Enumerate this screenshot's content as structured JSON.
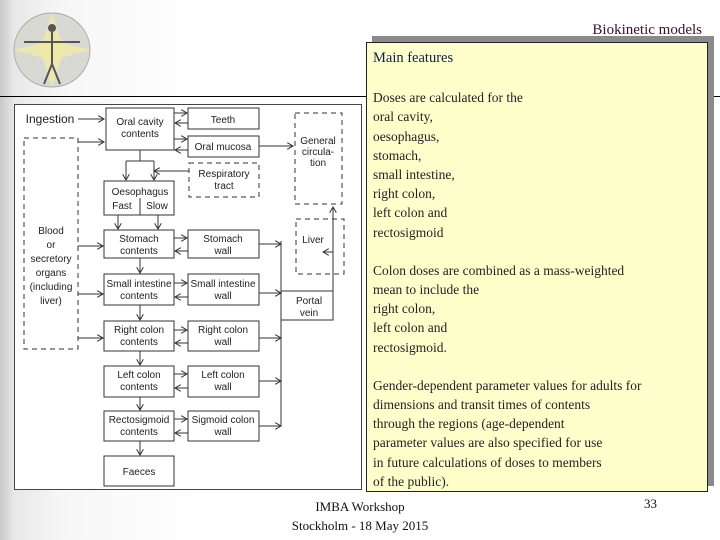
{
  "header": {
    "title": "Biokinetic models",
    "logo": "vitruvian-man-logo"
  },
  "diagram": {
    "ingestion": "Ingestion",
    "oral_cavity": [
      "Oral cavity",
      "contents"
    ],
    "teeth": "Teeth",
    "oral_mucosa": "Oral mucosa",
    "general_circulation": [
      "General",
      "circula-",
      "tion"
    ],
    "respiratory": [
      "Respiratory",
      "tract"
    ],
    "oesophagus": {
      "label": "Oesophagus",
      "fast": "Fast",
      "slow": "Slow"
    },
    "blood": [
      "Blood",
      "or",
      "secretory",
      "organs",
      "(including",
      "liver)"
    ],
    "stomach_contents": [
      "Stomach",
      "contents"
    ],
    "stomach_wall": [
      "Stomach",
      "wall"
    ],
    "liver": "Liver",
    "si_contents": [
      "Small intestine",
      "contents"
    ],
    "si_wall": [
      "Small intestine",
      "wall"
    ],
    "portal_vein": [
      "Portal",
      "vein"
    ],
    "rc_contents": [
      "Right colon",
      "contents"
    ],
    "rc_wall": [
      "Right colon",
      "wall"
    ],
    "lc_contents": [
      "Left colon",
      "contents"
    ],
    "lc_wall": [
      "Left colon",
      "wall"
    ],
    "rs_contents": [
      "Rectosigmoid",
      "contents"
    ],
    "sc_wall": [
      "Sigmoid colon",
      "wall"
    ],
    "faeces": "Faeces"
  },
  "panel": {
    "heading": "Main features",
    "p1": [
      "Doses are calculated for the",
      "oral cavity,",
      "oesophagus,",
      "stomach,",
      "small intestine,",
      "right colon,",
      "left colon and",
      "rectosigmoid"
    ],
    "p2": [
      "Colon doses are combined as a mass-weighted",
      "mean to include the",
      "right colon,",
      "left colon and",
      "rectosigmoid."
    ],
    "p3": [
      "Gender-dependent parameter values for adults for",
      "dimensions and transit times of contents",
      "through the regions (age-dependent",
      "parameter values are also specified for use",
      "in future calculations of doses to members",
      "of the public)."
    ]
  },
  "footer": {
    "line1": "IMBA Workshop",
    "line2": "Stockholm - 18 May 2015",
    "page": "33"
  }
}
